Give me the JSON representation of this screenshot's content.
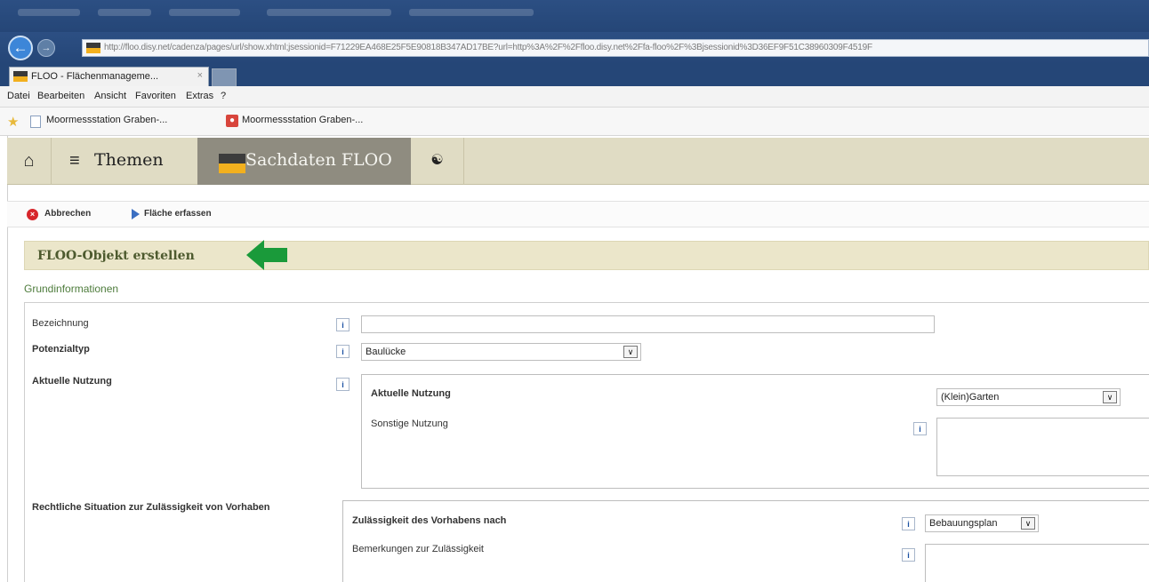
{
  "browser": {
    "url": "http://floo.disy.net/cadenza/pages/url/show.xhtml;jsessionid=F71229EA468E25F5E90818B347AD17BE?url=http%3A%2F%2Ffloo.disy.net%2Ffa-floo%2F%3Bjsessionid%3D36EF9F51C38960309F4519F",
    "tab_title": "FLOO - Flächenmanageme...",
    "tab_close": "×",
    "menu": [
      "Datei",
      "Bearbeiten",
      "Ansicht",
      "Favoriten",
      "Extras",
      "?"
    ],
    "favorites": [
      "Moormessstation Graben-...",
      "Moormessstation Graben-..."
    ]
  },
  "nav": {
    "home_icon": "⌂",
    "themen_label": "Themen",
    "sachdaten_label": "Sachdaten FLOO",
    "globe_icon": "☯"
  },
  "toolbar": {
    "cancel_label": "Abbrechen",
    "capture_label": "Fläche erfassen"
  },
  "form": {
    "title": "FLOO-Objekt erstellen",
    "section": "Grundinformationen",
    "fields": {
      "bezeichnung_label": "Bezeichnung",
      "bezeichnung_value": "",
      "potenzialtyp_label": "Potenzialtyp",
      "potenzialtyp_value": "Baulücke",
      "aktuelle_nutzung_label": "Aktuelle Nutzung",
      "aktuelle_nutzung_inner_label": "Aktuelle Nutzung",
      "aktuelle_nutzung_value": "(Klein)Garten",
      "sonstige_nutzung_label": "Sonstige Nutzung",
      "rechtliche_label": "Rechtliche Situation zur Zulässigkeit von Vorhaben",
      "zulaessigkeit_label": "Zulässigkeit des Vorhabens nach",
      "zulaessigkeit_value": "Bebauungsplan",
      "bemerkungen_label": "Bemerkungen zur Zulässigkeit"
    }
  },
  "colors": {
    "chrome_blue": "#254677",
    "nav_bg": "#e0dcc4",
    "nav_active": "#8f8c80",
    "header_bg": "#ebe6ca",
    "arrow_green": "#1a9a3a"
  }
}
